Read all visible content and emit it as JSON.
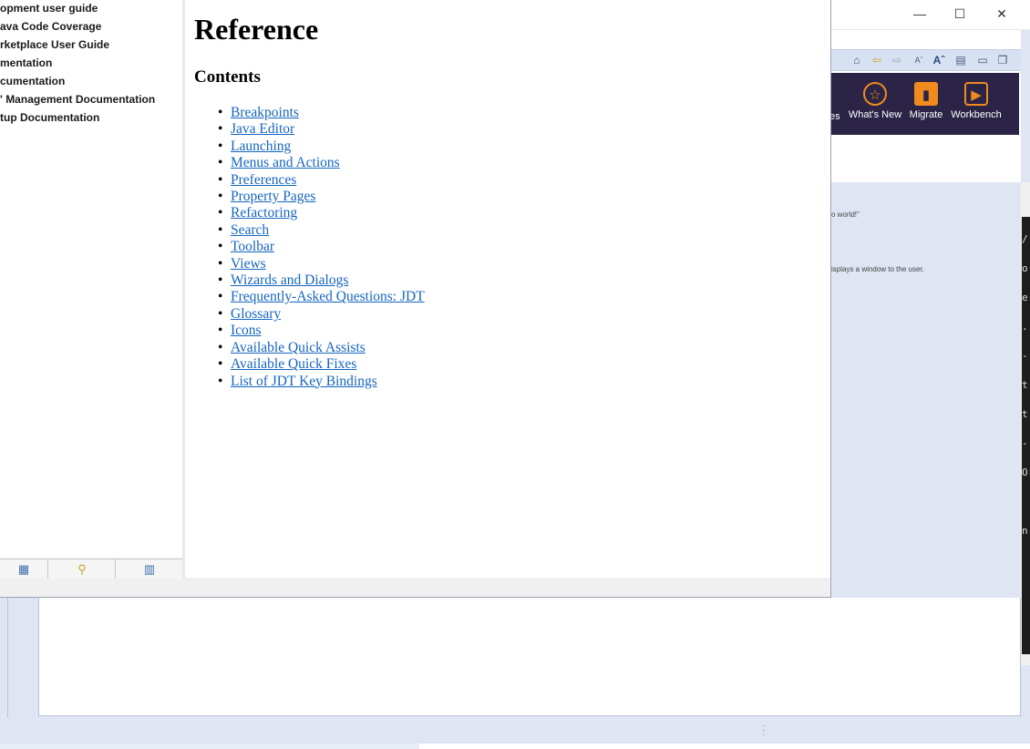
{
  "background_window": {
    "controls": {
      "minimize": "—",
      "maximize": "☐",
      "close": "✕"
    },
    "toolbar_icons": [
      "home-icon",
      "back-icon",
      "forward-icon",
      "font-smaller-icon",
      "font-larger-icon",
      "layout-icon",
      "minimize-view-icon",
      "restore-view-icon"
    ],
    "banner": {
      "partial_label": "es",
      "items": [
        {
          "label": "What's New",
          "icon": "star-icon"
        },
        {
          "label": "Migrate",
          "icon": "suitcase-icon"
        },
        {
          "label": "Workbench",
          "icon": "play-icon"
        }
      ],
      "accent": "#f08a1e",
      "bg": "#2b2447"
    },
    "snippets": {
      "line1": "o world!\"",
      "line2": "isplays a window to the user."
    }
  },
  "help": {
    "toc_items": [
      "opment user guide",
      "ava Code Coverage",
      "rketplace User Guide",
      "mentation",
      "cumentation",
      "' Management Documentation",
      "tup Documentation"
    ],
    "toc_tabs": [
      "contents-icon",
      "search-icon",
      "bookmarks-icon"
    ],
    "content": {
      "title": "Reference",
      "subtitle": "Contents",
      "links": [
        "Breakpoints",
        "Java Editor",
        "Launching",
        "Menus and Actions",
        "Preferences",
        "Property Pages",
        "Refactoring",
        "Search",
        "Toolbar",
        "Views",
        "Wizards and Dialogs",
        "Frequently-Asked Questions: JDT",
        "Glossary",
        "Icons",
        "Available Quick Assists",
        "Available Quick Fixes",
        "List of JDT Key Bindings"
      ],
      "link_color": "#1565c0"
    }
  }
}
